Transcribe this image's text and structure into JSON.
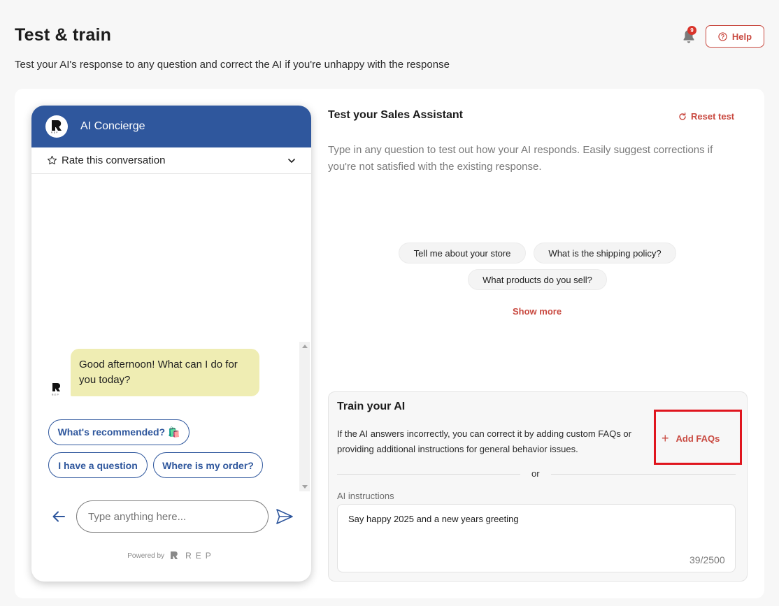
{
  "header": {
    "title": "Test & train",
    "subtitle": "Test your AI's response to any question and correct the AI if you're unhappy with the response",
    "notification_count": "9",
    "help_label": "Help"
  },
  "chat": {
    "title": "AI Concierge",
    "rate_label": "Rate this conversation",
    "message": "Good afternoon! What can I do for you today?",
    "chips": [
      "What's recommended? 🛍️",
      "I have a question",
      "Where is my order?"
    ],
    "input_placeholder": "Type anything here...",
    "powered_by": "Powered by",
    "brand": "REP"
  },
  "test_panel": {
    "title": "Test your Sales Assistant",
    "reset_label": "Reset test",
    "description": "Type in any question to test out how your AI responds. Easily suggest corrections if you're not satisfied with the existing response.",
    "suggestions": [
      "Tell me about your store",
      "What is the shipping policy?",
      "What products do you sell?"
    ],
    "show_more": "Show more"
  },
  "train": {
    "title": "Train your AI",
    "description": "If the AI answers incorrectly, you can correct it by adding custom FAQs or providing additional instructions for general behavior issues.",
    "add_faqs_label": "Add FAQs",
    "or_label": "or",
    "instructions_label": "AI instructions",
    "instructions_value": "Say happy 2025 and a new years greeting",
    "char_count": "39/2500"
  },
  "colors": {
    "brand_blue": "#2f579d",
    "accent_red": "#c94a41",
    "bubble": "#efedb3",
    "highlight_box": "#e0151e"
  }
}
